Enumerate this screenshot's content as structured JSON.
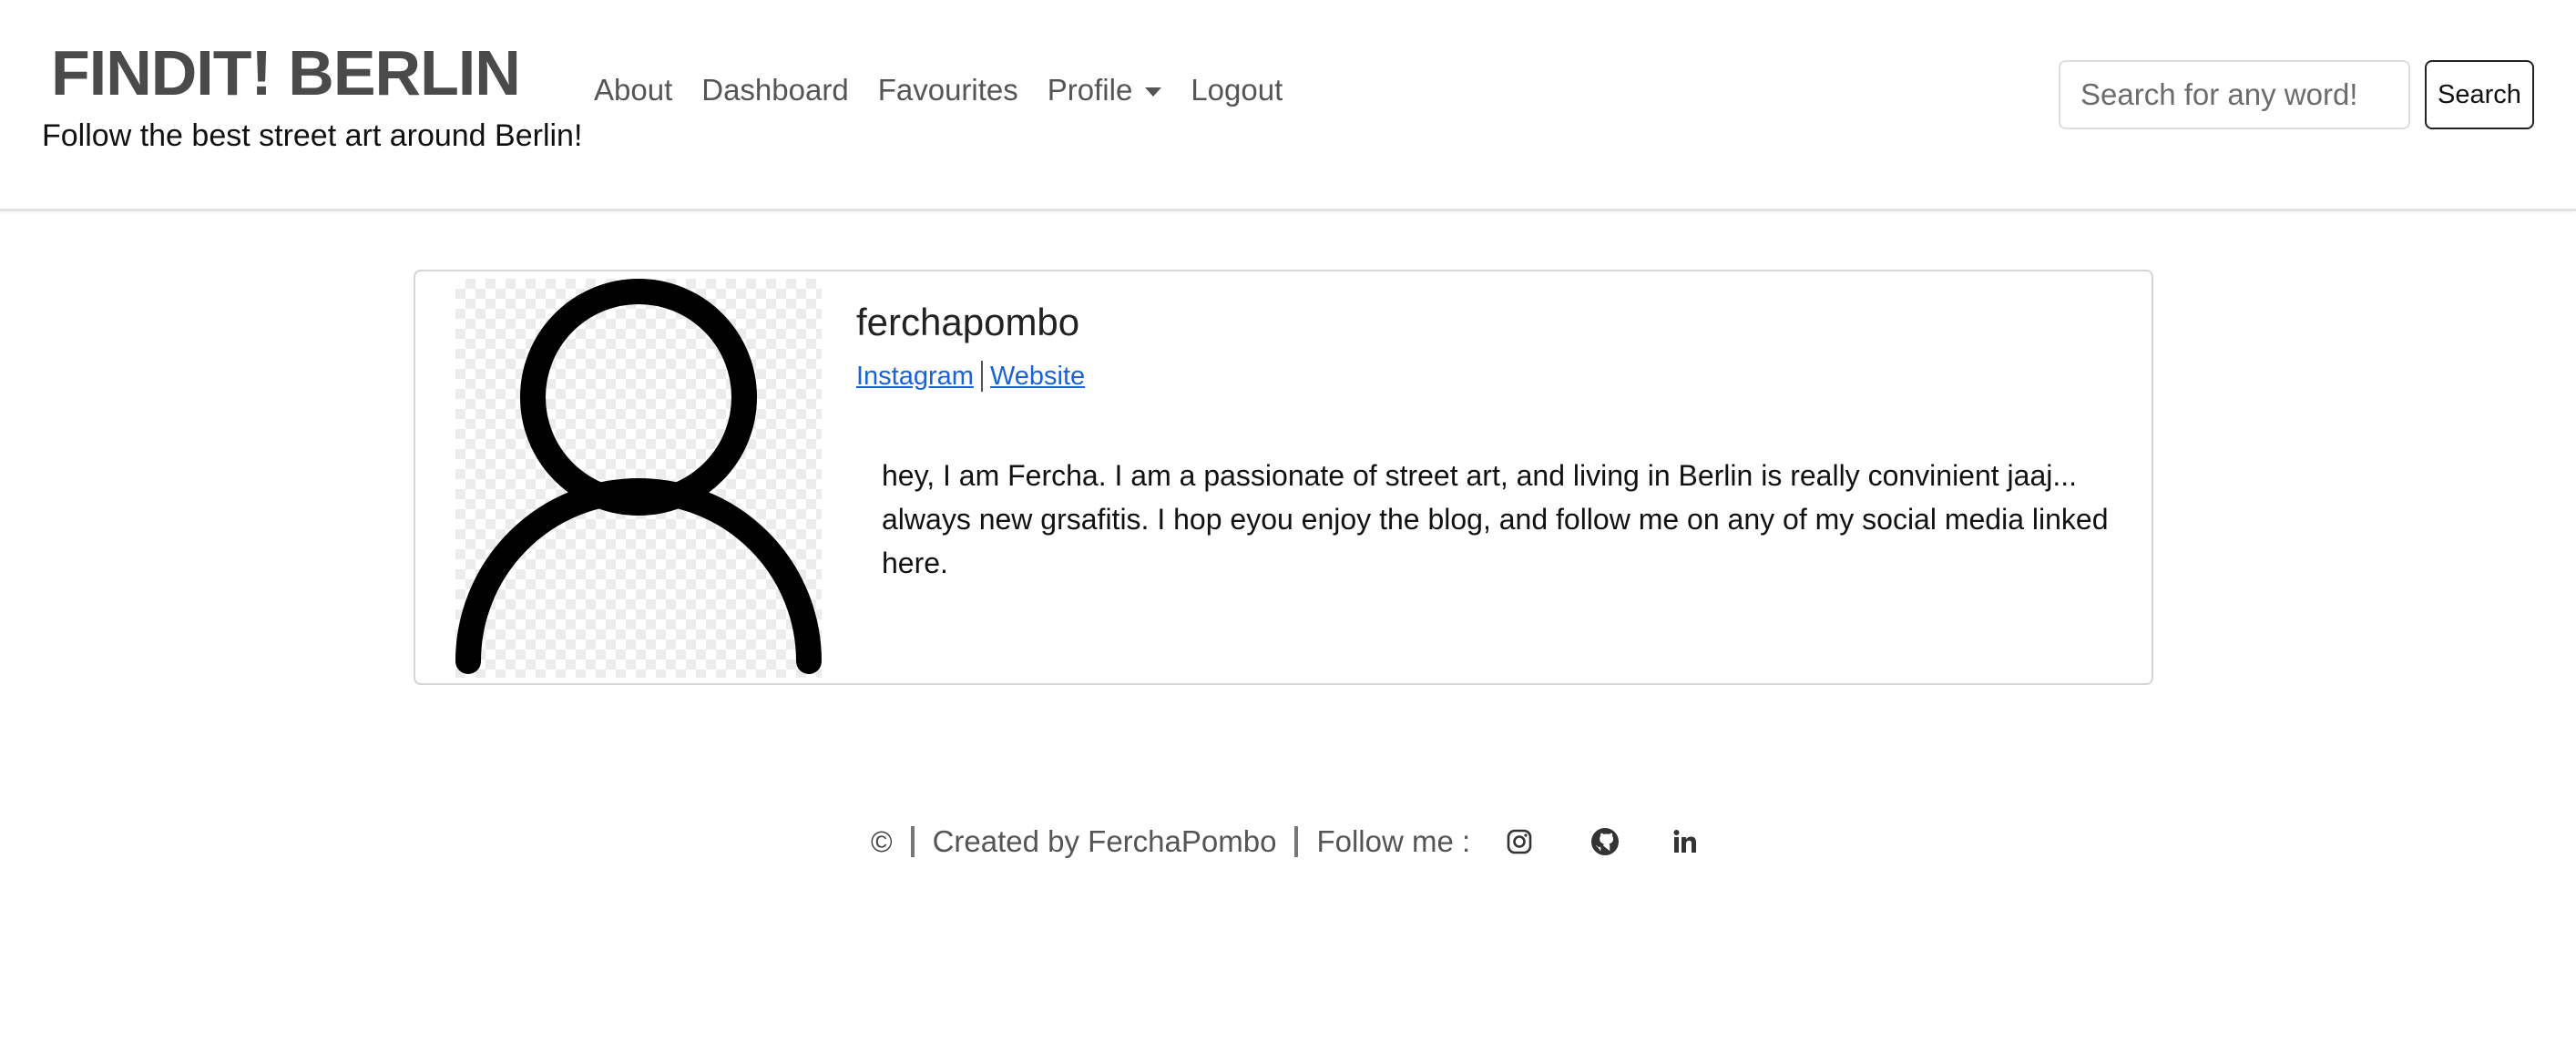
{
  "brand": {
    "title": "FINDIT! BERLIN",
    "tagline": "Follow the best street art around Berlin!"
  },
  "nav": {
    "about": "About",
    "dashboard": "Dashboard",
    "favourites": "Favourites",
    "profile": "Profile",
    "logout": "Logout"
  },
  "search": {
    "placeholder": "Search for any word!",
    "button_label": "Search"
  },
  "profile": {
    "avatar_icon": "user-silhouette-icon",
    "username": "ferchapombo",
    "links": {
      "instagram": "Instagram",
      "separator": "|",
      "website": "Website"
    },
    "bio": "hey, I am Fercha. I am a passionate of street art, and living in Berlin is really convinient jaaj... always new grsafitis. I hop eyou enjoy the blog, and follow me on any of my social media linked here."
  },
  "footer": {
    "copyright": "©",
    "created_by": "Created by FerchaPombo",
    "follow_me": "Follow me :",
    "icons": [
      "instagram-icon",
      "github-icon",
      "linkedin-icon"
    ]
  },
  "colors": {
    "brand_text": "#4a4a4a",
    "link": "#1a63d6",
    "nav_text": "#555555"
  }
}
